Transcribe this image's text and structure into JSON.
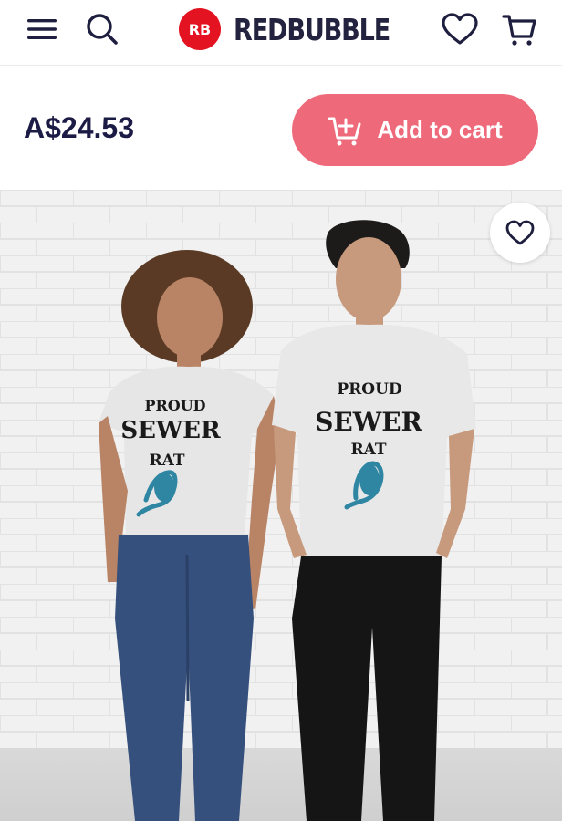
{
  "header": {
    "brand_name": "REDBUBBLE",
    "brand_mark_text": "RB",
    "icons": [
      "menu-icon",
      "search-icon",
      "heart-icon",
      "cart-icon"
    ]
  },
  "product": {
    "price": "A$24.53",
    "add_to_cart_label": "Add to cart",
    "design_lines": [
      "PROUD",
      "SEWER",
      "RAT"
    ]
  },
  "colors": {
    "accent": "#ee6a7b",
    "brand_red": "#e41321",
    "text_dark": "#1b1b45"
  }
}
